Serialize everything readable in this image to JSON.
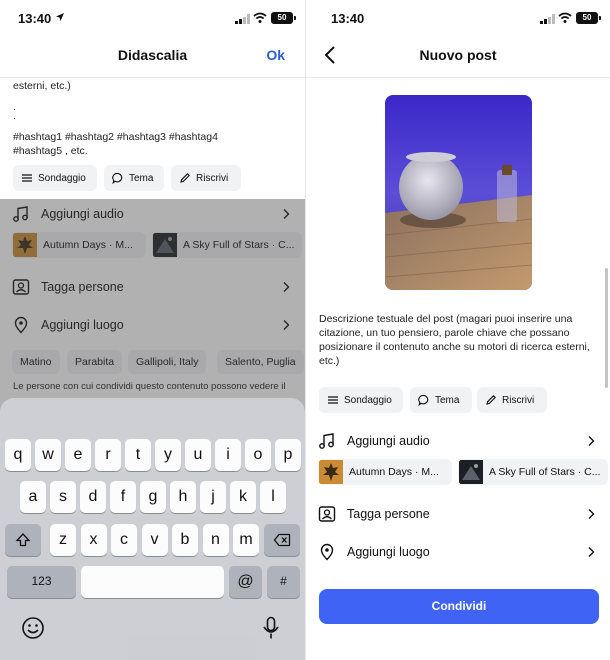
{
  "left": {
    "status": {
      "time": "13:40",
      "battery": "50"
    },
    "nav": {
      "title": "Didascalia",
      "ok_label": "Ok"
    },
    "caption": {
      "line1": "esterni, etc.)",
      "dot1": ".",
      "dot2": ".",
      "hashtags1": "#hashtag1 #hashtag2 #hashtag3 #hashtag4",
      "hashtags2": "#hashtag5 , etc."
    },
    "chips": {
      "poll": "Sondaggio",
      "theme": "Tema",
      "rewrite": "Riscrivi"
    },
    "rows": {
      "audio": "Aggiungi audio",
      "tag": "Tagga persone",
      "place": "Aggiungi luogo"
    },
    "music": [
      {
        "title": "Autumn Days · M..."
      },
      {
        "title": "A Sky Full of Stars · C..."
      }
    ],
    "locations": [
      "Matino",
      "Parabita",
      "Gallipoli, Italy",
      "Salento, Puglia"
    ],
    "visibility_note": "Le persone con cui condividi questo contenuto possono vedere il",
    "keyboard": {
      "row1": [
        "q",
        "w",
        "e",
        "r",
        "t",
        "y",
        "u",
        "i",
        "o",
        "p"
      ],
      "row2": [
        "a",
        "s",
        "d",
        "f",
        "g",
        "h",
        "j",
        "k",
        "l"
      ],
      "row3": [
        "z",
        "x",
        "c",
        "v",
        "b",
        "n",
        "m"
      ],
      "numbers_key": "123",
      "at_key": "@",
      "hash_key": "#"
    }
  },
  "right": {
    "status": {
      "time": "13:40",
      "battery": "50"
    },
    "nav": {
      "title": "Nuovo post"
    },
    "description": "Descrizione testuale del post (magari puoi inserire una citazione, un tuo pensiero, parole chiave che possano posizionare il contenuto anche su motori di ricerca esterni, etc.)",
    "chips": {
      "poll": "Sondaggio",
      "theme": "Tema",
      "rewrite": "Riscrivi"
    },
    "rows": {
      "audio": "Aggiungi audio",
      "tag": "Tagga persone",
      "place": "Aggiungi luogo"
    },
    "music": [
      {
        "title": "Autumn Days · M..."
      },
      {
        "title": "A Sky Full of Stars · C..."
      }
    ],
    "share_label": "Condividi"
  },
  "colors": {
    "accent_blue": "#3e63f5",
    "ok_blue": "#2b5ccc"
  }
}
